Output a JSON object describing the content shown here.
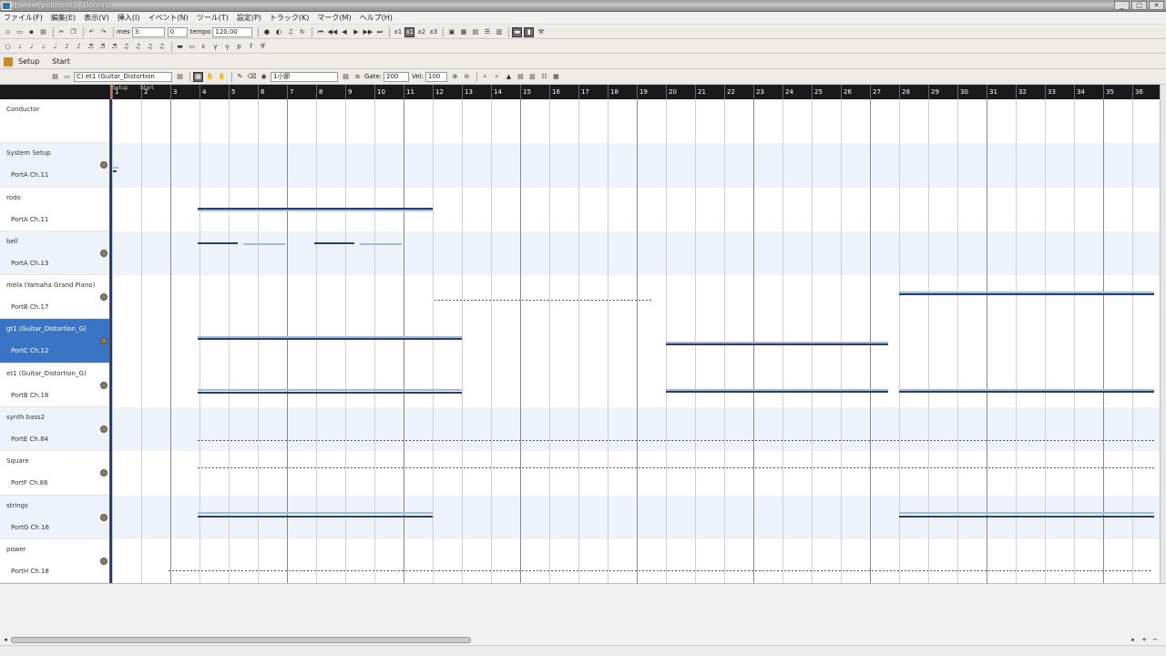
{
  "window": {
    "title": "[sweet pop.dms] - Domino"
  },
  "menu": [
    "ファイル(F)",
    "編集(E)",
    "表示(V)",
    "挿入(I)",
    "イベント(N)",
    "ツール(T)",
    "設定(P)",
    "トラック(K)",
    "マーク(M)",
    "ヘルプ(H)"
  ],
  "toolbar": {
    "position_label": "mes",
    "position_value": "3:",
    "beat_value": "0",
    "tempo_label": "tempo",
    "tempo_value": "120.00",
    "gate_label": "Gate:",
    "gate_value": "200",
    "vel_label": "Vel:",
    "vel_value": "100",
    "track_select": "C) et1 (Guitar_Distortion",
    "quantize_select": "1小節"
  },
  "tabs": [
    "Setup",
    "Start"
  ],
  "ruler": {
    "markers": [
      "Setup",
      "Start"
    ],
    "measures": [
      "1",
      "2",
      "3",
      "4",
      "5",
      "6",
      "7",
      "8",
      "9",
      "10",
      "11",
      "12",
      "13",
      "14",
      "15",
      "16",
      "17",
      "18",
      "19",
      "20",
      "21",
      "22",
      "23",
      "24",
      "25",
      "26",
      "27",
      "28",
      "29",
      "30",
      "31",
      "32",
      "33",
      "34",
      "35",
      "36"
    ]
  },
  "tracks": [
    {
      "name": "Conductor",
      "port": "",
      "selected": false
    },
    {
      "name": "System Setup",
      "port": "PortA  Ch.11",
      "selected": false
    },
    {
      "name": "rodo",
      "port": "PortA  Ch.11",
      "selected": false
    },
    {
      "name": "bell",
      "port": "PortA  Ch.13",
      "selected": false
    },
    {
      "name": "mela (Yamaha Grand Piano)",
      "port": "PortB  Ch.17",
      "selected": false
    },
    {
      "name": "gt1 (Guitar_Distortion_G)",
      "port": "PortC  Ch.12",
      "selected": true
    },
    {
      "name": "et1 (Guitar_Distortion_G)",
      "port": "PortB  Ch.18",
      "selected": false
    },
    {
      "name": "synth bass2",
      "port": "PortE  Ch.84",
      "selected": false
    },
    {
      "name": "Square",
      "port": "PortF  Ch.86",
      "selected": false
    },
    {
      "name": "strings",
      "port": "PortG  Ch.16",
      "selected": false
    },
    {
      "name": "power",
      "port": "PortH  Ch.18",
      "selected": false
    }
  ]
}
